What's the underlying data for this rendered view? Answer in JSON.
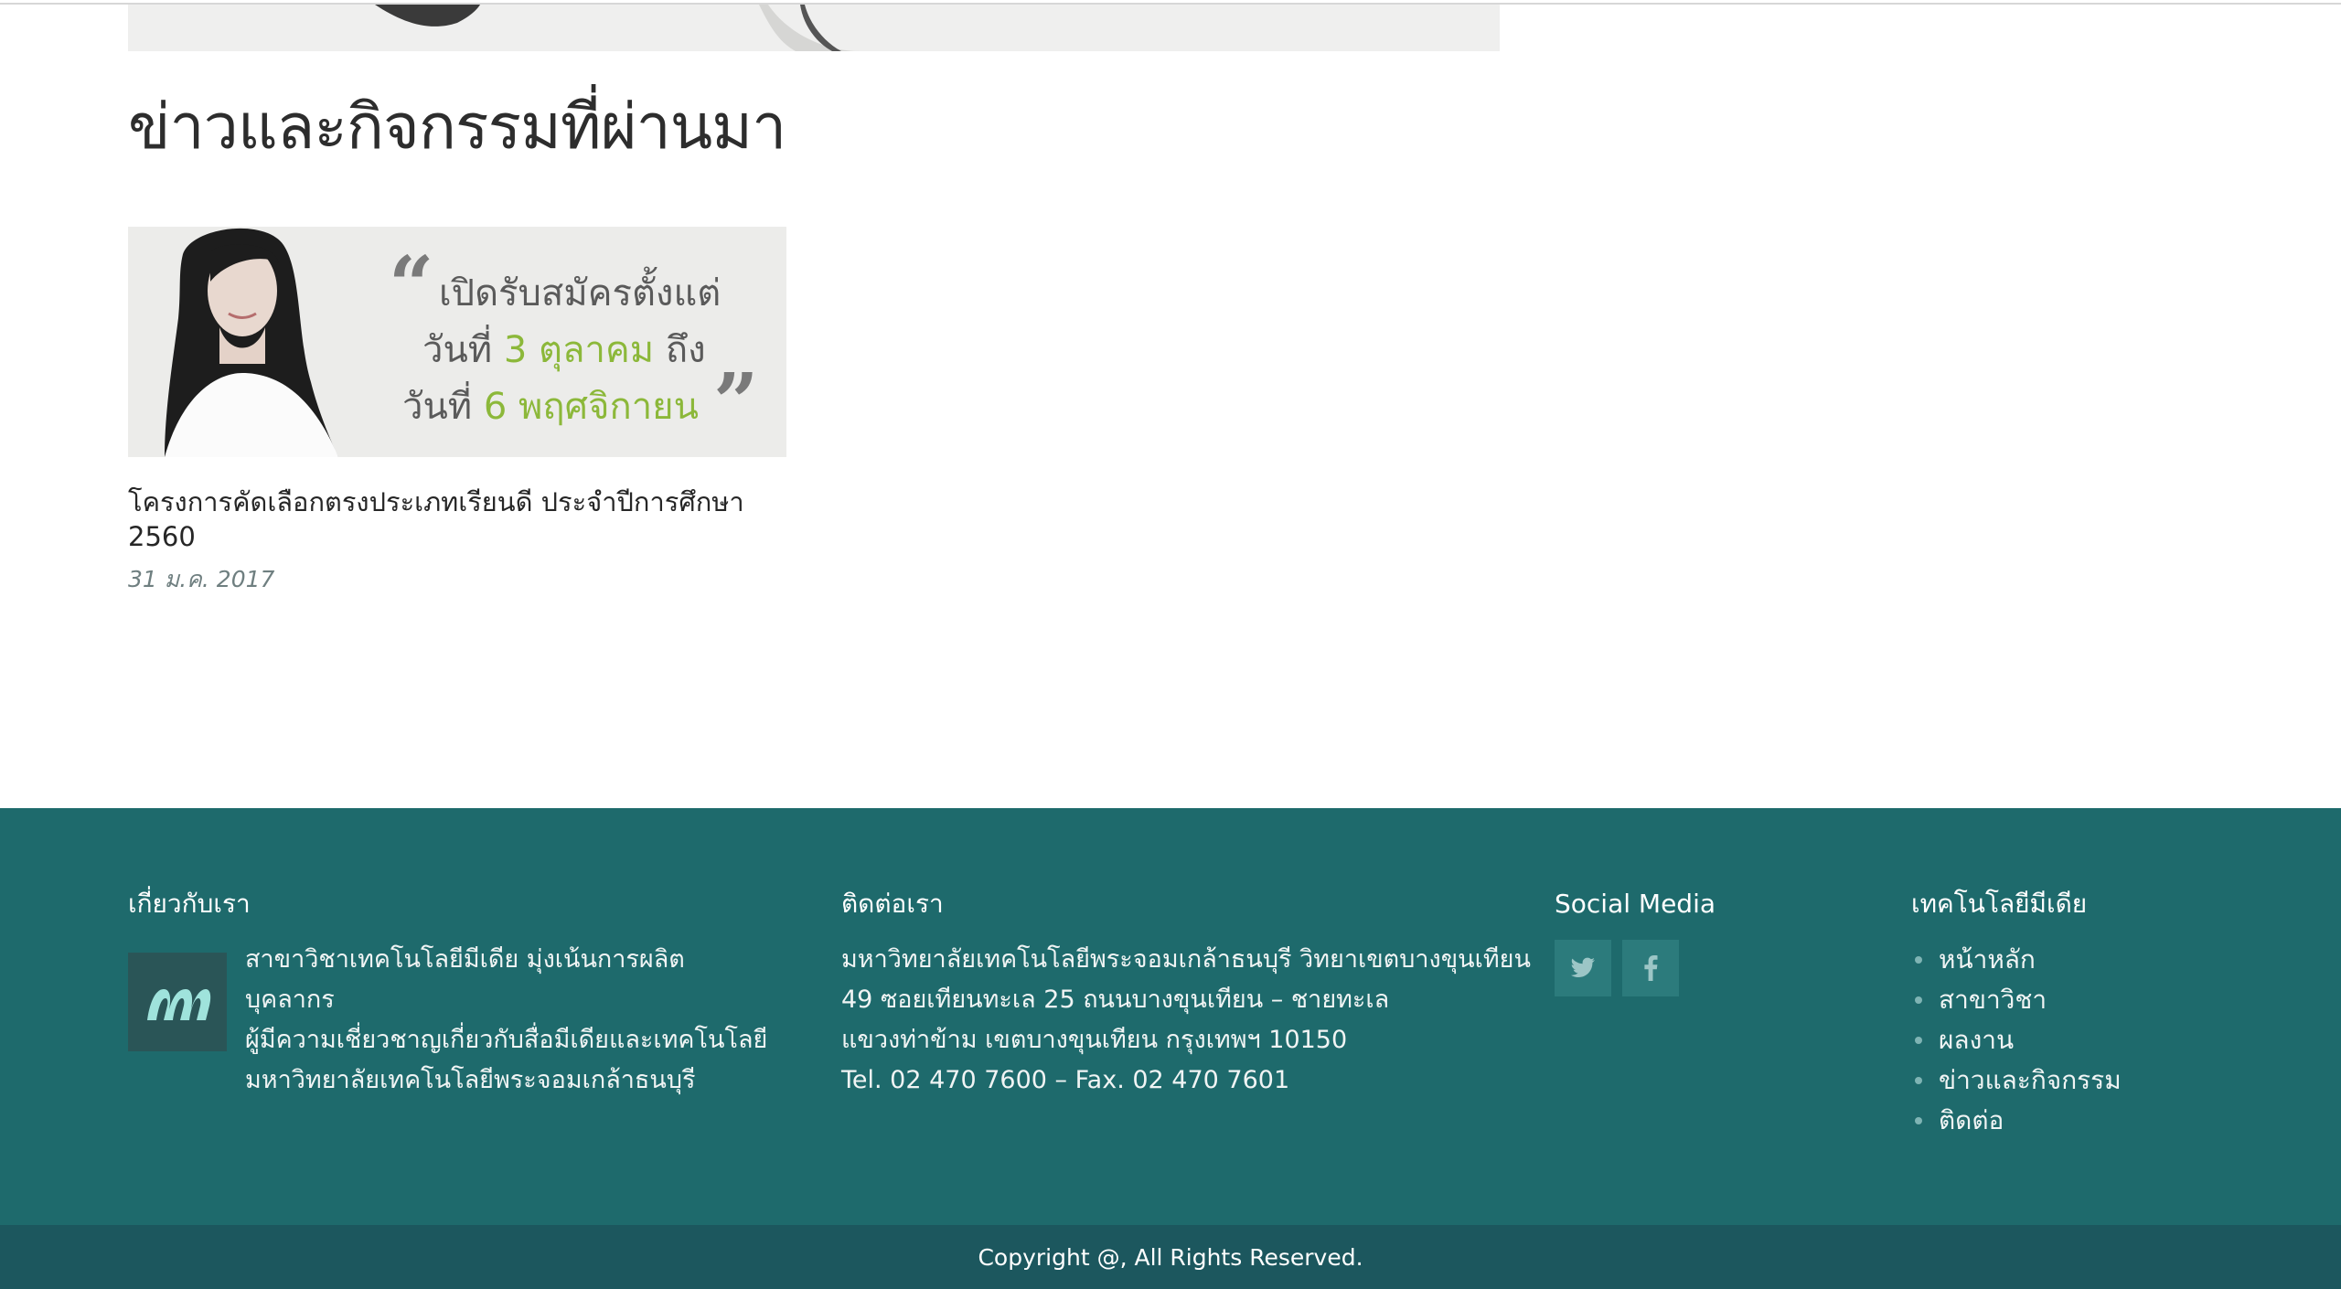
{
  "section": {
    "title": "ข่าวและกิจกรรมที่ผ่านมา"
  },
  "news": [
    {
      "title": "โครงการคัดเลือกตรงประเภทเรียนดี ประจำปีการศึกษา 2560",
      "date": "31 ม.ค. 2017",
      "promo": {
        "line1": "เปิดรับสมัครตั้งแต่",
        "line2_prefix": "วันที่",
        "line2_highlight": "3 ตุลาคม",
        "line2_suffix": "ถึง",
        "line3_prefix": "วันที่",
        "line3_highlight": "6 พฤศจิกายน"
      }
    }
  ],
  "footer": {
    "about": {
      "heading": "เกี่ยวกับเรา",
      "lines": [
        "สาขาวิชาเทคโนโลยีมีเดีย มุ่งเน้นการผลิตบุคลากร",
        "ผู้มีความเชี่ยวชาญเกี่ยวกับสื่อมีเดียและเทคโนโลยี",
        "มหาวิทยาลัยเทคโนโลยีพระจอมเกล้าธนบุรี"
      ]
    },
    "contact": {
      "heading": "ติดต่อเรา",
      "lines": [
        "มหาวิทยาลัยเทคโนโลยีพระจอมเกล้าธนบุรี วิทยาเขตบางขุนเทียน",
        "49 ซอยเทียนทะเล 25 ถนนบางขุนเทียน – ชายทะเล",
        "แขวงท่าข้าม เขตบางขุนเทียน กรุงเทพฯ 10150",
        "Tel. 02 470 7600 – Fax. 02 470 7601"
      ]
    },
    "social": {
      "heading": "Social Media",
      "icons": [
        "twitter-icon",
        "facebook-icon"
      ]
    },
    "links": {
      "heading": "เทคโนโลยีมีเดีย",
      "items": [
        "หน้าหลัก",
        "สาขาวิชา",
        "ผลงาน",
        "ข่าวและกิจกรรม",
        "ติดต่อ"
      ]
    },
    "copyright": "Copyright @, All Rights Reserved."
  },
  "colors": {
    "footer_bg": "#1e6a6c",
    "copyright_bg": "#1c575e",
    "promo_highlight": "#8cb83a",
    "social_button_bg": "#2c7b7c"
  }
}
